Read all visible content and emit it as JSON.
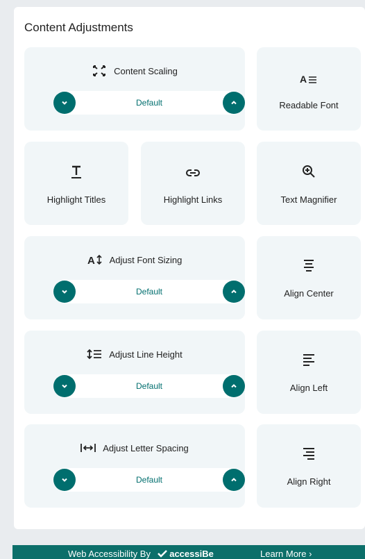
{
  "section_title": "Content Adjustments",
  "content_scaling": {
    "label": "Content Scaling",
    "value": "Default",
    "icon": "expand-arrows-icon"
  },
  "readable_font": {
    "label": "Readable Font",
    "icon": "readable-font-icon"
  },
  "highlight_titles": {
    "label": "Highlight Titles",
    "icon": "underlined-t-icon"
  },
  "highlight_links": {
    "label": "Highlight Links",
    "icon": "link-icon"
  },
  "text_magnifier": {
    "label": "Text Magnifier",
    "icon": "zoom-in-icon"
  },
  "font_sizing": {
    "label": "Adjust Font Sizing",
    "value": "Default",
    "icon": "font-size-icon"
  },
  "align_center": {
    "label": "Align Center",
    "icon": "align-center-icon"
  },
  "line_height": {
    "label": "Adjust Line Height",
    "value": "Default",
    "icon": "line-height-icon"
  },
  "align_left": {
    "label": "Align Left",
    "icon": "align-left-icon"
  },
  "letter_spacing": {
    "label": "Adjust Letter Spacing",
    "value": "Default",
    "icon": "letter-spacing-icon"
  },
  "align_right": {
    "label": "Align Right",
    "icon": "align-right-icon"
  },
  "footer": {
    "text": "Web Accessibility By",
    "brand": "accessiBe",
    "learn_more": "Learn More ›"
  },
  "colors": {
    "accent": "#006e6e",
    "tile_bg": "#f1f6f8",
    "footer_bg": "#0c6f6a"
  }
}
